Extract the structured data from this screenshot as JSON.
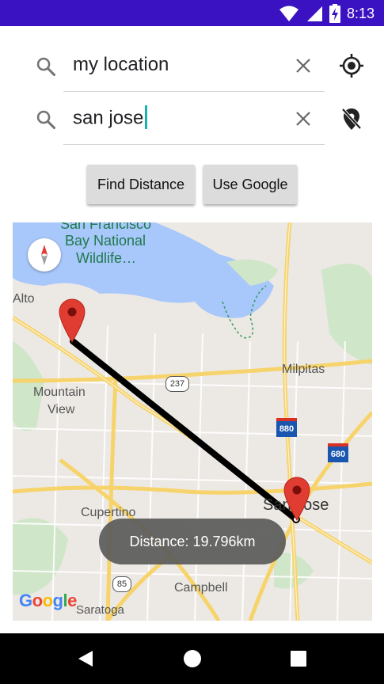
{
  "status_bar": {
    "time": "8:13"
  },
  "search": {
    "origin": {
      "value": "my location"
    },
    "destination": {
      "value": "san jose"
    }
  },
  "buttons": {
    "find_distance": "Find Distance",
    "use_google": "Use Google"
  },
  "map": {
    "labels": {
      "sf_bay_1": "San Francisco",
      "sf_bay_2": "Bay National",
      "sf_bay_3": "Wildlife…",
      "alto": "Alto",
      "milpitas": "Milpitas",
      "mountain": "Mountain",
      "view": "View",
      "cupertino": "Cupertino",
      "san_jose": "San Jose",
      "campbell": "Campbell",
      "saratoga": "Saratoga"
    },
    "shields": {
      "r237": "237",
      "r880": "880",
      "r680": "680",
      "r85": "85"
    },
    "google_logo": "Google",
    "route_color": "#000000",
    "marker_color": "#d93025"
  },
  "toast": {
    "text": "Distance: 19.796km"
  },
  "icons": {
    "wifi": "wifi-icon",
    "signal": "signal-icon",
    "battery": "battery-charging-icon",
    "search": "search-icon",
    "clear": "close-icon",
    "location": "my-location-icon",
    "location_off": "location-off-icon",
    "compass": "compass-icon",
    "back": "back-icon",
    "home": "home-icon",
    "recents": "recents-icon"
  }
}
